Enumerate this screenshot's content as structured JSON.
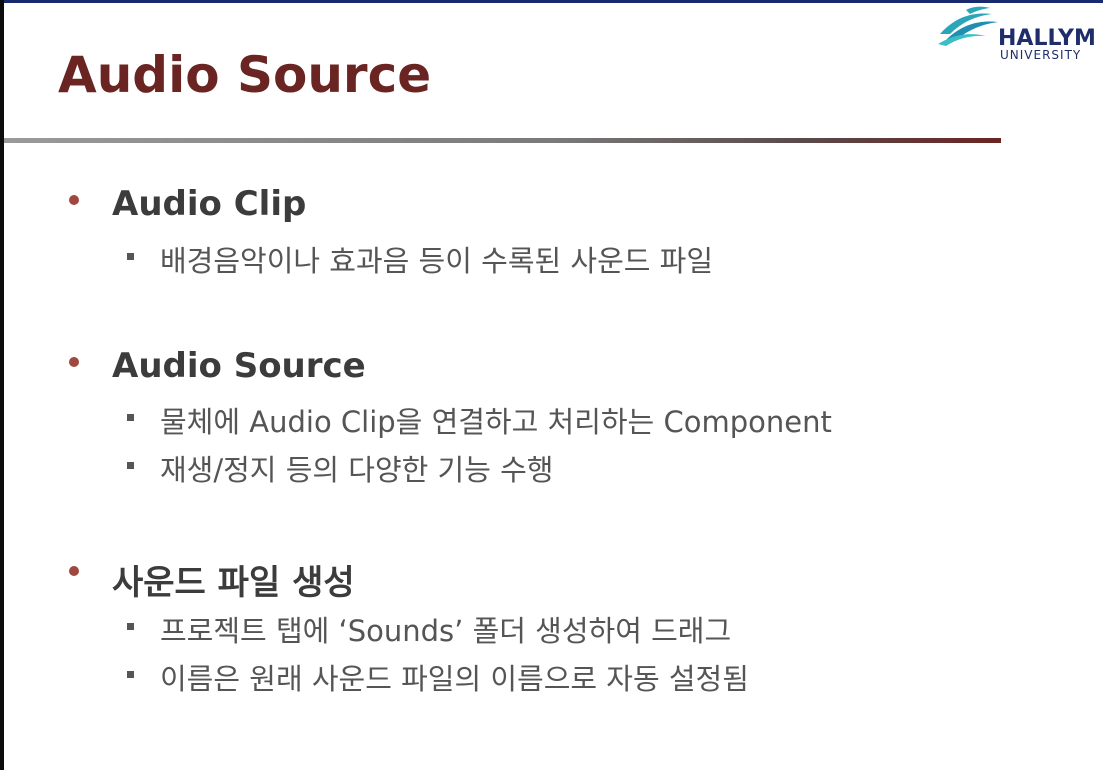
{
  "slide": {
    "title": "Audio Source",
    "logo": {
      "name": "HALLYM",
      "subtitle": "UNIVERSITY"
    }
  },
  "bullets": [
    {
      "heading": "Audio Clip",
      "items": [
        "배경음악이나 효과음 등이 수록된 사운드 파일"
      ]
    },
    {
      "heading": "Audio Source",
      "items": [
        "물체에 Audio Clip을 연결하고 처리하는 Component",
        "재생/정지 등의 다양한 기능 수행"
      ]
    },
    {
      "heading": "사운드 파일 생성",
      "items": [
        "프로젝트 탭에 ‘Sounds’ 폴더 생성하여 드래그",
        "이름은 원래 사운드 파일의 이름으로 자동 설정됨"
      ]
    }
  ],
  "colors": {
    "title": "#6a2422",
    "bullet_dot": "#a0473f",
    "logo": "#1f2e6b",
    "logo_wave": "#2aa6b8"
  }
}
